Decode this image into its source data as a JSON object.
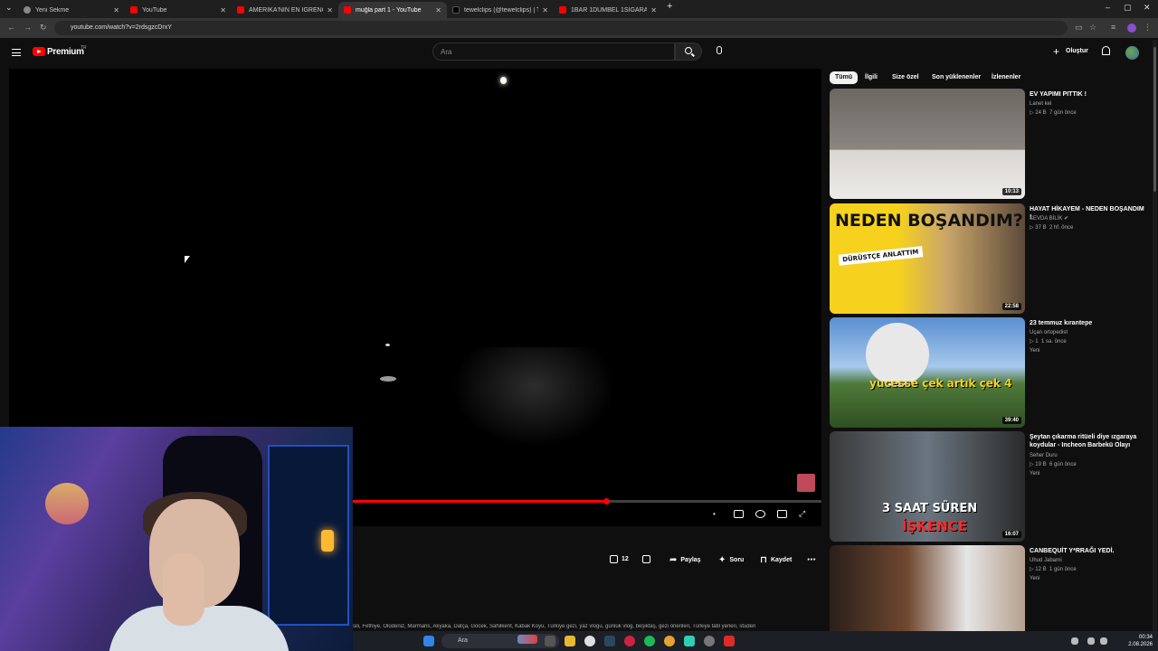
{
  "tabs": [
    {
      "label": "Yeni Sekme",
      "icon": "new-tab-icon"
    },
    {
      "label": "YouTube",
      "icon": "youtube-icon"
    },
    {
      "label": "AMERİKA'NIN EN İĞRENÇ PRO",
      "icon": "youtube-icon"
    },
    {
      "label": "muğla part 1 - YouTube",
      "icon": "youtube-icon",
      "active": true
    },
    {
      "label": "tewelclips (@tewelclips) | TikTok",
      "icon": "tiktok-icon"
    },
    {
      "label": "1BAR 1DUMBEL 1SİGARA w/ G",
      "icon": "youtube-icon"
    }
  ],
  "address_bar": {
    "url": "youtube.com/watch?v=2rdsgzcDrxY"
  },
  "header": {
    "logo_text": "Premium",
    "logo_badge": "TR",
    "search_placeholder": "Ara",
    "create_label": "Oluştur"
  },
  "player": {
    "progress": 0.54
  },
  "actions": {
    "likes": "12",
    "share_label": "Paylaş",
    "ask_label": "Soru",
    "save_label": "Kaydet"
  },
  "description_tags": "sili, Fethiye, Ölüdeniz, Marmaris, Akyaka, Datça, Göcek, Sahilkent, Kabak Koyu, Türkiye gezi, yaz vlogu, günlük vlog, beşiktaş, gezi önerileri, Türkiye tatil yerleri, studen",
  "filter_chips": [
    {
      "label": "Tümü",
      "active": true
    },
    {
      "label": "İlgili"
    },
    {
      "label": "Size özel"
    },
    {
      "label": "Son yüklenenler"
    },
    {
      "label": "İzlenenler"
    }
  ],
  "recommendations": [
    {
      "title": "EV YAPIMI PITTIK !",
      "channel": "Lanet kel",
      "views": "24 B",
      "age": "7 gün önce",
      "badge": "",
      "duration": "10:13"
    },
    {
      "title": "HAYAT HİKAYEM - NEDEN BOŞANDIM !",
      "channel": "SEVDA BİLİK",
      "views": "37 B",
      "age": "2 hf. önce",
      "badge": "",
      "duration": "22:58",
      "thumb_text": "NEDEN BOŞANDIM?",
      "thumb_sub": "DÜRÜSTÇE ANLATTIM"
    },
    {
      "title": "23 temmuz kırantepe",
      "channel": "Uçan ortopedist",
      "views": "1",
      "age": "1 sa. önce",
      "badge": "Yeni",
      "duration": "39:40",
      "thumb_text": "yucesse  çek artık çek 4"
    },
    {
      "title": "Şeytan çıkarma ritüeli diye ızgaraya koydular - Incheon Barbekü Olayı",
      "channel": "Seher Duru",
      "views": "19 B",
      "age": "6 gün önce",
      "badge": "Yeni",
      "duration": "16:07",
      "thumb_text": "3 SAAT SÜREN",
      "thumb_sub": "İŞKENCE"
    },
    {
      "title": "CANBEQUİT Y*RRAĞI YEDİ.",
      "channel": "Uhud Jabarni",
      "views": "12 B",
      "age": "1 gün önce",
      "badge": "Yeni",
      "duration": ""
    }
  ],
  "taskbar": {
    "search_label": "Ara",
    "time": "00:34",
    "date": "2.08.2026"
  }
}
